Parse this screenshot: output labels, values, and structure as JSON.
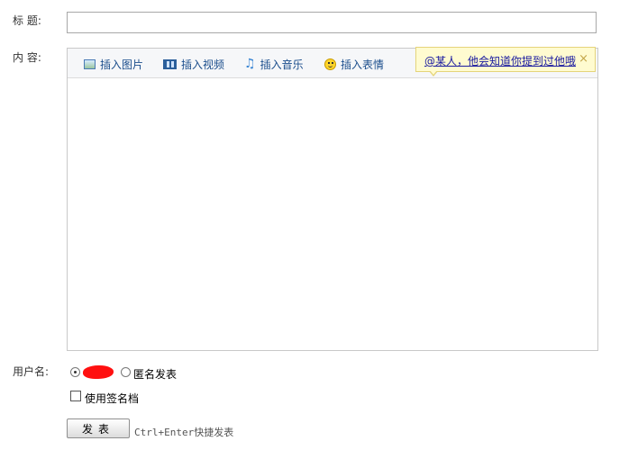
{
  "form": {
    "title_label": "标  题:",
    "title_value": "",
    "content_label": "内  容:",
    "username_label": "用户名:"
  },
  "toolbar": {
    "items": [
      {
        "label": "插入图片",
        "icon": "image-icon"
      },
      {
        "label": "插入视频",
        "icon": "video-icon"
      },
      {
        "label": "插入音乐",
        "icon": "music-note-icon"
      },
      {
        "label": "插入表情",
        "icon": "smiley-icon"
      }
    ]
  },
  "tooltip": {
    "text": "@某人，他会知道你提到过他哦~",
    "close": "×"
  },
  "options": {
    "anonymous_label": "匿名发表",
    "signature_label": "使用签名档"
  },
  "submit": {
    "label": "发表",
    "hint": "Ctrl+Enter快捷发表"
  }
}
